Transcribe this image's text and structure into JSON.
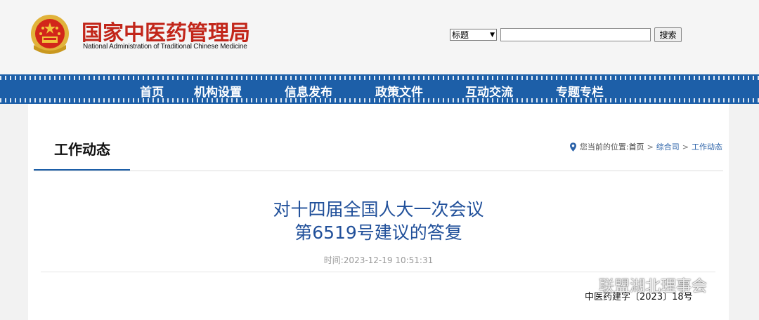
{
  "header": {
    "site_title": "国家中医药管理局",
    "site_subtitle": "National Administration of Traditional Chinese Medicine",
    "search": {
      "select_value": "标题",
      "input_value": "",
      "button_label": "搜索"
    }
  },
  "nav": {
    "items": [
      "首页",
      "机构设置",
      "信息发布",
      "政策文件",
      "互动交流",
      "专题专栏"
    ]
  },
  "section": {
    "title": "工作动态",
    "breadcrumb": {
      "prefix": "您当前的位置:",
      "items": [
        "首页",
        "综合司",
        "工作动态"
      ]
    }
  },
  "article": {
    "title_line1": "对十四届全国人大一次会议",
    "title_line2": "第6519号建议的答复",
    "meta": "时间:2023-12-19 10:51:31",
    "doc_number": "中医药建字〔2023〕18号"
  },
  "watermark": {
    "text": "联盟湖北理事会"
  },
  "colors": {
    "brand_red": "#c2261a",
    "nav_blue": "#1d5fa8",
    "title_blue": "#21509a"
  }
}
